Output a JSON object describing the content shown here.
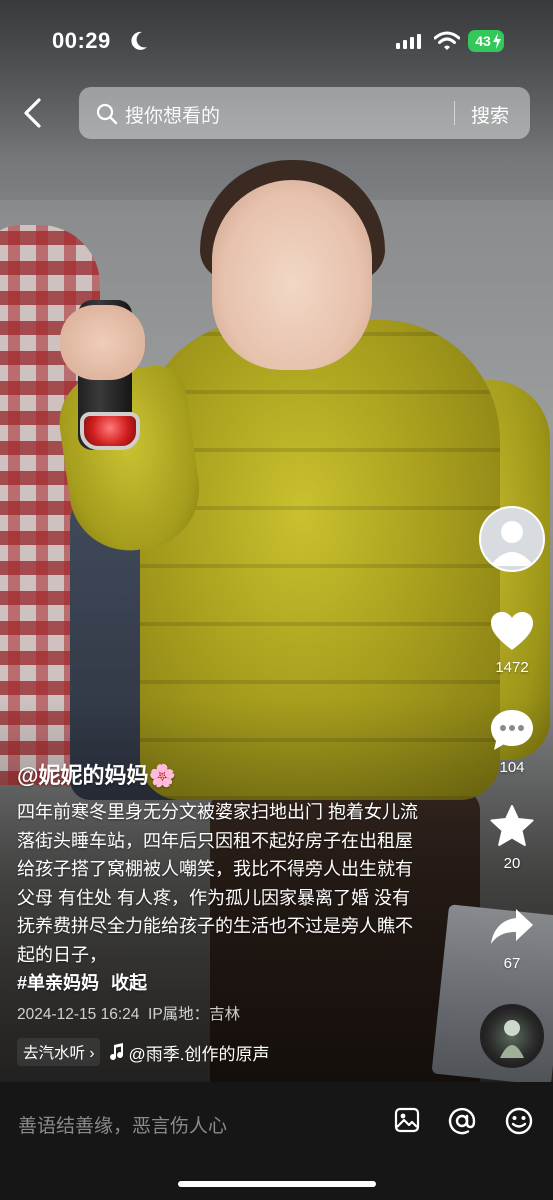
{
  "status_bar": {
    "time": "00:29",
    "battery": "43",
    "battery_color": "#34c759"
  },
  "search": {
    "placeholder": "搜你想看的",
    "button": "搜索"
  },
  "right_rail": {
    "likes": "1472",
    "comments": "104",
    "favorites": "20",
    "shares": "67"
  },
  "caption": {
    "author": "@妮妮的妈妈",
    "author_emoji": "🌸",
    "text": "四年前寒冬里身无分文被婆家扫地出门 抱着女儿流落街头睡车站，四年后只因租不起好房子在出租屋给孩子搭了窝棚被人嘲笑，我比不得旁人出生就有父母 有住处 有人疼，作为孤儿因家暴离了婚 没有抚养费拼尽全力能给孩子的生活也不过是旁人瞧不起的日子，",
    "hashtag": "#单亲妈妈",
    "collapse": "收起",
    "date": "2024-12-15 16:24",
    "ip": "IP属地：吉林"
  },
  "music": {
    "listen_label": "去汽水听",
    "sound": "@雨季.创作的原声"
  },
  "comment_bar": {
    "placeholder": "善语结善缘，恶言伤人心"
  },
  "icons": [
    "moon-icon",
    "signal-icon",
    "wifi-icon",
    "back-icon",
    "search-icon",
    "avatar-icon",
    "heart-icon",
    "comment-icon",
    "star-icon",
    "share-icon",
    "music-note-icon",
    "image-icon",
    "at-icon",
    "emoji-icon"
  ]
}
